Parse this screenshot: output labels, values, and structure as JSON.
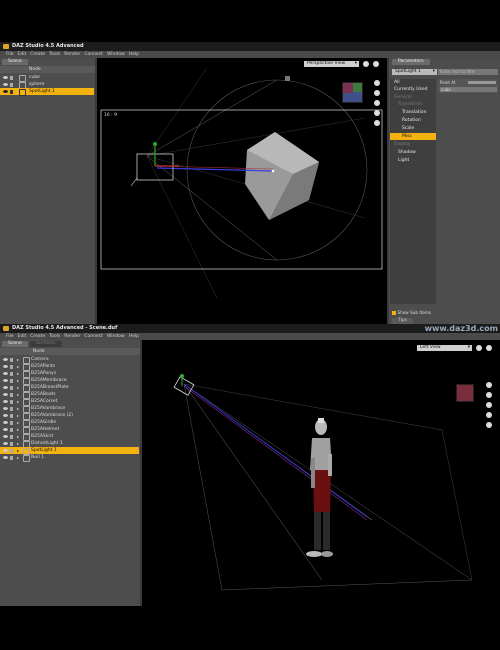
{
  "brand": "www.daz3d.com",
  "top": {
    "title": "DAZ Studio 4.5 Advanced",
    "menu": [
      "File",
      "Edit",
      "Create",
      "Tools",
      "Render",
      "Connect",
      "Window",
      "Help"
    ],
    "scene_tab": "Scene",
    "tree_header": "Node",
    "nodes": [
      {
        "label": "cube",
        "selected": false
      },
      {
        "label": "sphere",
        "selected": false
      },
      {
        "label": "SpotLight 1",
        "selected": true
      }
    ],
    "viewport": {
      "camera_select": "Perspective View",
      "frame_label": "16 : 9"
    },
    "params": {
      "tab": "Parameters",
      "node_select": "SpotLight 1",
      "search_placeholder": "Enter text to filter",
      "value_field": "Point At",
      "value_sub": "cube",
      "categories": [
        {
          "label": "All",
          "state": "normal"
        },
        {
          "label": "Currently Used",
          "state": "normal"
        },
        {
          "label": "General",
          "state": "dim"
        },
        {
          "label": "Transforms",
          "state": "dim"
        },
        {
          "label": "Translation",
          "state": "normal"
        },
        {
          "label": "Rotation",
          "state": "normal"
        },
        {
          "label": "Scale",
          "state": "normal"
        },
        {
          "label": "Misc",
          "state": "selected"
        },
        {
          "label": "Display",
          "state": "dim"
        },
        {
          "label": "Shadow",
          "state": "normal"
        },
        {
          "label": "Light",
          "state": "normal"
        }
      ],
      "show_sub_items": "Show Sub Items",
      "tips_tab": "Tips"
    }
  },
  "bottom": {
    "title": "DAZ Studio 4.5 Advanced - Scene.duf",
    "menu": [
      "File",
      "Edit",
      "Create",
      "Tools",
      "Render",
      "Connect",
      "Window",
      "Help"
    ],
    "tabs": [
      "Scene",
      "Surfaces"
    ],
    "tree_header": "Node",
    "nodes": [
      {
        "label": "Camera",
        "selected": false
      },
      {
        "label": "B25APants",
        "selected": false
      },
      {
        "label": "B25APonys",
        "selected": false
      },
      {
        "label": "B25AMembrace",
        "selected": false
      },
      {
        "label": "B25ABreastPlate",
        "selected": false
      },
      {
        "label": "B25ABoots",
        "selected": false
      },
      {
        "label": "B25ACorset",
        "selected": false
      },
      {
        "label": "B25AVambrace",
        "selected": false
      },
      {
        "label": "B25AVambrace (2)",
        "selected": false
      },
      {
        "label": "B25AGirdle",
        "selected": false
      },
      {
        "label": "B25AHelmet",
        "selected": false
      },
      {
        "label": "B25ASkirt",
        "selected": false
      },
      {
        "label": "DistantLight 1",
        "selected": false
      },
      {
        "label": "SpotLight 1",
        "selected": true
      },
      {
        "label": "Null 1",
        "selected": false
      }
    ],
    "viewport": {
      "camera_select": "Left View"
    }
  },
  "colors": {
    "selection": "#f3b20f",
    "panel": "#4d4d4d",
    "viewport": "#000000"
  }
}
